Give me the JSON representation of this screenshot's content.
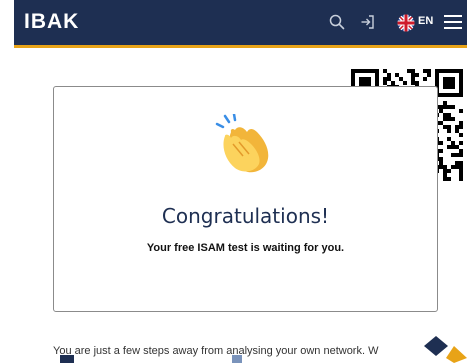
{
  "header": {
    "logo": "IBAK",
    "language": "EN",
    "icons": [
      "search-icon",
      "login-icon",
      "uk-flag-icon",
      "menu-icon"
    ],
    "colors": {
      "background": "#1e2f52",
      "accent": "#e8a317"
    }
  },
  "card": {
    "emoji": "clapping-hands-icon",
    "title": "Congratulations!",
    "subtitle": "Your free ISAM test is waiting for you."
  },
  "body": {
    "text": "You are just a few steps away from analysing your own network. W"
  },
  "qr": {
    "icon": "qr-code-icon"
  }
}
